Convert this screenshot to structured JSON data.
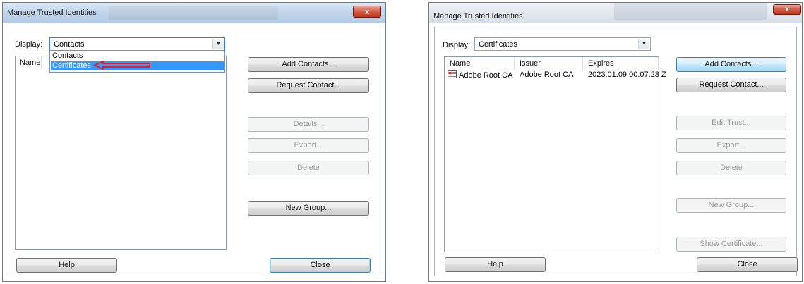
{
  "left_dialog": {
    "title": "Manage Trusted Identities",
    "close_glyph": "x",
    "display_label": "Display:",
    "display_value": "Contacts",
    "dropdown_options": [
      "Contacts",
      "Certificates"
    ],
    "dropdown_selected": "Certificates",
    "list_columns": [
      "Name"
    ],
    "buttons": {
      "add_contacts": "Add Contacts...",
      "request_contact": "Request Contact...",
      "details": "Details...",
      "export": "Export...",
      "delete": "Delete",
      "new_group": "New Group...",
      "help": "Help",
      "close": "Close"
    },
    "annotation_color": "#e0202a"
  },
  "right_dialog": {
    "title": "Manage Trusted Identities",
    "close_glyph": "x",
    "display_label": "Display:",
    "display_value": "Certificates",
    "list_columns": [
      "Name",
      "Issuer",
      "Expires"
    ],
    "rows": [
      {
        "name": "Adobe Root CA",
        "issuer": "Adobe Root CA",
        "expires": "2023.01.09 00:07:23 Z",
        "icon": "certificate-icon"
      }
    ],
    "buttons": {
      "add_contacts": "Add Contacts...",
      "request_contact": "Request Contact...",
      "edit_trust": "Edit Trust...",
      "export": "Export...",
      "delete": "Delete",
      "new_group": "New Group...",
      "show_certificate": "Show Certificate...",
      "help": "Help",
      "close": "Close"
    }
  },
  "colors": {
    "selection": "#3399ff",
    "close_button": "#c2331b",
    "titlebar": "#c2d6ec"
  }
}
